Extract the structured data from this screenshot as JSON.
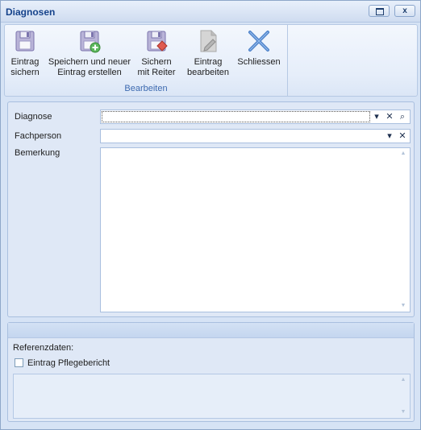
{
  "window": {
    "title": "Diagnosen",
    "restore_icon": "restore-icon",
    "close_glyph": "x"
  },
  "ribbon": {
    "group_label": "Bearbeiten",
    "buttons": [
      {
        "label": "Eintrag\nsichern",
        "icon": "floppy-save-icon"
      },
      {
        "label": "Speichern und neuer\nEintrag erstellen",
        "icon": "floppy-save-new-icon"
      },
      {
        "label": "Sichern\nmit Reiter",
        "icon": "floppy-save-tab-icon"
      },
      {
        "label": "Eintrag\nbearbeiten",
        "icon": "edit-document-icon"
      },
      {
        "label": "Schliessen",
        "icon": "close-x-icon"
      }
    ]
  },
  "form": {
    "diagnose_label": "Diagnose",
    "diagnose_value": "",
    "fachperson_label": "Fachperson",
    "fachperson_value": "",
    "bemerkung_label": "Bemerkung",
    "bemerkung_value": ""
  },
  "referenz": {
    "heading": "Referenzdaten:",
    "checkbox_label": "Eintrag Pflegebericht",
    "checked": false
  },
  "colors": {
    "title_text": "#15428b",
    "group_label": "#3d6ab0",
    "panel_bg": "#dfe8f6",
    "close_icon": "#4a7fc7"
  }
}
